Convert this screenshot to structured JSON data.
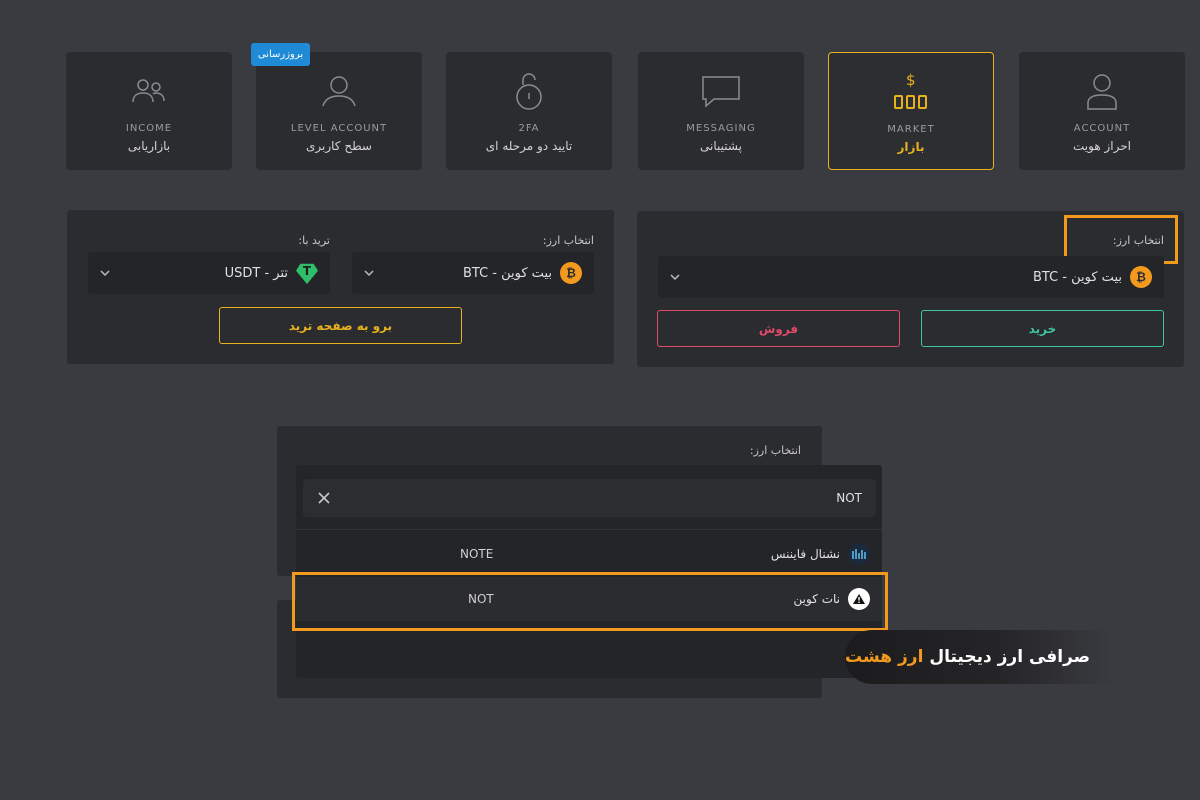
{
  "badge": "بروزرسانی",
  "menu": [
    {
      "en": "INCOME",
      "fa": "بازاریابی",
      "icon": "users-icon"
    },
    {
      "en": "LEVEL ACCOUNT",
      "fa": "سطح کاربری",
      "icon": "user-level-icon"
    },
    {
      "en": "2FA",
      "fa": "تایید دو مرحله ای",
      "icon": "lock-icon"
    },
    {
      "en": "MESSAGING",
      "fa": "پشتیبانی",
      "icon": "chat-icon"
    },
    {
      "en": "MARKET",
      "fa": "بازار",
      "icon": "market-icon",
      "active": true
    },
    {
      "en": "ACCOUNT",
      "fa": "احراز هویت",
      "icon": "account-icon"
    }
  ],
  "trade_panel": {
    "select_label": "انتخاب ارز:",
    "trade_with_label": "ترید با:",
    "coin_value": "بیت کوین - BTC",
    "quote_value": "تتر - USDT",
    "go_button": "برو به صفحه ترید"
  },
  "buy_panel": {
    "select_label": "انتخاب ارز:",
    "coin_value": "بیت کوین - BTC",
    "buy_button": "خرید",
    "sell_button": "فروش"
  },
  "dropdown": {
    "label": "انتخاب ارز:",
    "search_value": "NOT",
    "results": [
      {
        "name": "نشنال فایننس",
        "symbol": "NOTE"
      },
      {
        "name": "نات کوین",
        "symbol": "NOT"
      }
    ]
  },
  "caption": {
    "text": "صرافی ارز دیجیتال",
    "brand": "ارز هشت"
  },
  "colors": {
    "background": "#3a3b40",
    "panel": "#2b2c30",
    "accent": "#e8b21e",
    "highlight": "#f39a1e",
    "buy": "#3ec6a0",
    "sell": "#e04a6a",
    "badge": "#1f8bd6"
  }
}
